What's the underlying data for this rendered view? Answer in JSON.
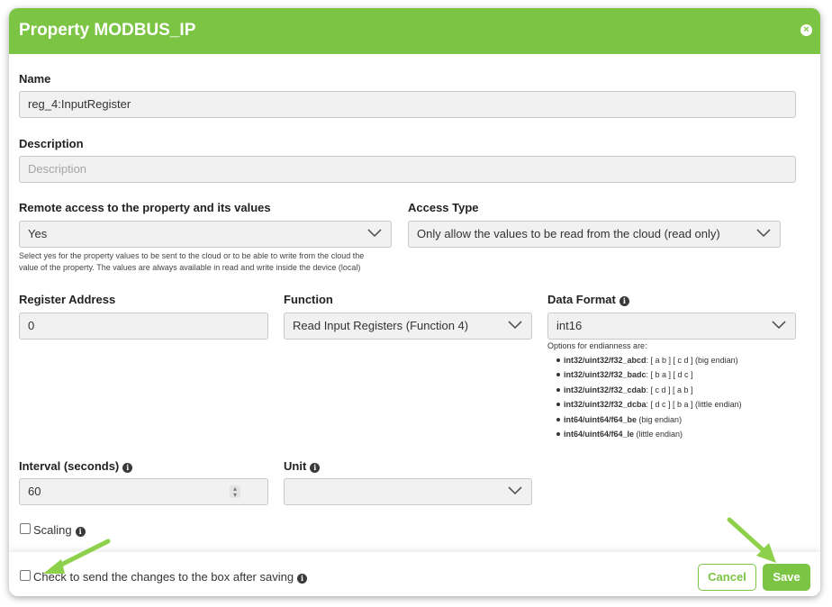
{
  "header": {
    "title": "Property MODBUS_IP",
    "close_icon": "close-icon"
  },
  "name": {
    "label": "Name",
    "value": "reg_4:InputRegister"
  },
  "description": {
    "label": "Description",
    "placeholder": "Description"
  },
  "remote_access": {
    "label": "Remote access to the property and its values",
    "value": "Yes",
    "help_line1": "Select yes for the property values to be sent to the cloud or to be able to write from the cloud the",
    "help_line2": "value of the property. The values are always available in read and write inside the device (local)"
  },
  "access_type": {
    "label": "Access Type",
    "value": "Only allow the values to be read from the cloud (read only)"
  },
  "register_address": {
    "label": "Register Address",
    "value": "0"
  },
  "function": {
    "label": "Function",
    "value": "Read Input Registers (Function 4)"
  },
  "data_format": {
    "label": "Data Format",
    "value": "int16",
    "endian_intro": "Options for endianness are:",
    "options": [
      {
        "name": "int32/uint32/f32_abcd",
        "desc": ": [ a b ] [ c d ] (big endian)"
      },
      {
        "name": "int32/uint32/f32_badc",
        "desc": ": [ b a ] [ d c ]"
      },
      {
        "name": "int32/uint32/f32_cdab",
        "desc": ": [ c d ] [ a b ]"
      },
      {
        "name": "int32/uint32/f32_dcba",
        "desc": ": [ d c ] [ b a ] (little endian)"
      },
      {
        "name": "int64/uint64/f64_be",
        "desc": " (big endian)"
      },
      {
        "name": "int64/uint64/f64_le",
        "desc": " (little endian)"
      }
    ]
  },
  "interval": {
    "label": "Interval (seconds)",
    "value": "60"
  },
  "unit": {
    "label": "Unit",
    "value": ""
  },
  "scaling": {
    "label": "Scaling",
    "checked": false
  },
  "footer": {
    "send_label": "Check to send the changes to the box after saving",
    "cancel_label": "Cancel",
    "save_label": "Save"
  },
  "colors": {
    "accent": "#7cc443",
    "annotation_arrow": "#8dd14a"
  }
}
